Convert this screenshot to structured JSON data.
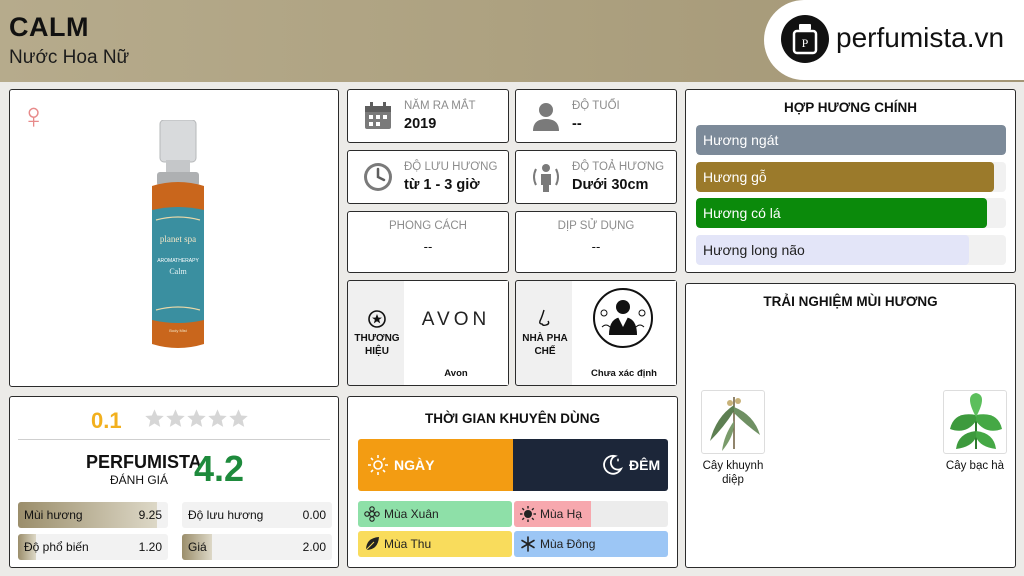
{
  "header": {
    "title": "CALM",
    "subtitle": "Nước Hoa Nữ",
    "logo_text": "perfumista.vn"
  },
  "product": {
    "gender_icon": "venus-icon",
    "image": "perfume-bottle-image",
    "bottle_text": [
      "planet spa",
      "AROMATHERAPY",
      "Calm",
      "Body Mist"
    ]
  },
  "info": {
    "release": {
      "label": "NĂM RA MẮT",
      "value": "2019",
      "icon": "calendar-icon"
    },
    "age": {
      "label": "ĐỘ TUỔI",
      "value": "--",
      "icon": "user-icon"
    },
    "longevity": {
      "label": "ĐỘ LƯU HƯƠNG",
      "value": "từ 1 - 3 giờ",
      "icon": "clock-icon"
    },
    "sillage": {
      "label": "ĐỘ TOẢ HƯƠNG",
      "value": "Dưới 30cm",
      "icon": "sillage-icon"
    },
    "style": {
      "label": "PHONG CÁCH",
      "value": "--"
    },
    "occasion": {
      "label": "DỊP SỬ DỤNG",
      "value": "--"
    }
  },
  "brand": {
    "label": "THƯƠNG HIỆU",
    "logo_text": "AVON",
    "name": "Avon",
    "icon": "badge-icon"
  },
  "perfumer": {
    "label": "NHÀ PHA CHẾ",
    "name": "Chưa xác định",
    "icon": "nose-icon"
  },
  "accords": {
    "title": "HỢP HƯƠNG CHÍNH",
    "items": [
      {
        "label": "Hương ngát",
        "color": "#7c8a99",
        "fill": 1.0
      },
      {
        "label": "Hương gỗ",
        "color": "#9b7a2b",
        "fill": 0.96
      },
      {
        "label": "Hương có lá",
        "color": "#0b8a0b",
        "fill": 0.94
      },
      {
        "label": "Hương long não",
        "color": "#e3e5f8",
        "fill": 0.88
      }
    ]
  },
  "experience": {
    "title": "TRẢI NGHIỆM MÙI HƯƠNG",
    "ingredients": [
      {
        "name": "Cây khuynh diệp",
        "icon": "eucalyptus-icon"
      },
      {
        "name": "Cây bạc hà",
        "icon": "mint-icon"
      }
    ]
  },
  "rating": {
    "user_score": "0.1",
    "stars_filled": 0,
    "stars_total": 5,
    "perfumista_label": "PERFUMISTA",
    "perfumista_sub": "ĐÁNH GIÁ",
    "perfumista_score": "4.2",
    "metrics": [
      {
        "label": "Mùi hương",
        "value": "9.25",
        "fill": 0.925
      },
      {
        "label": "Độ lưu hương",
        "value": "0.00",
        "fill": 0.0
      },
      {
        "label": "Độ phổ biến",
        "value": "1.20",
        "fill": 0.12
      },
      {
        "label": "Giá",
        "value": "2.00",
        "fill": 0.2
      }
    ]
  },
  "usage": {
    "title": "THỜI GIAN KHUYÊN DÙNG",
    "day_label": "NGÀY",
    "night_label": "ĐÊM",
    "day_fill": 1.0,
    "night_fill": 1.0,
    "seasons": [
      {
        "label": "Mùa Xuân",
        "color": "#8ee0a8",
        "fill": 1.0,
        "icon": "flower-icon"
      },
      {
        "label": "Mùa Hạ",
        "color": "#f7a8ae",
        "fill": 0.5,
        "icon": "sun-icon"
      },
      {
        "label": "Mùa Thu",
        "color": "#f9dc5c",
        "fill": 1.0,
        "icon": "leaf-icon"
      },
      {
        "label": "Mùa Đông",
        "color": "#9cc6f5",
        "fill": 1.0,
        "icon": "snowflake-icon"
      }
    ]
  }
}
